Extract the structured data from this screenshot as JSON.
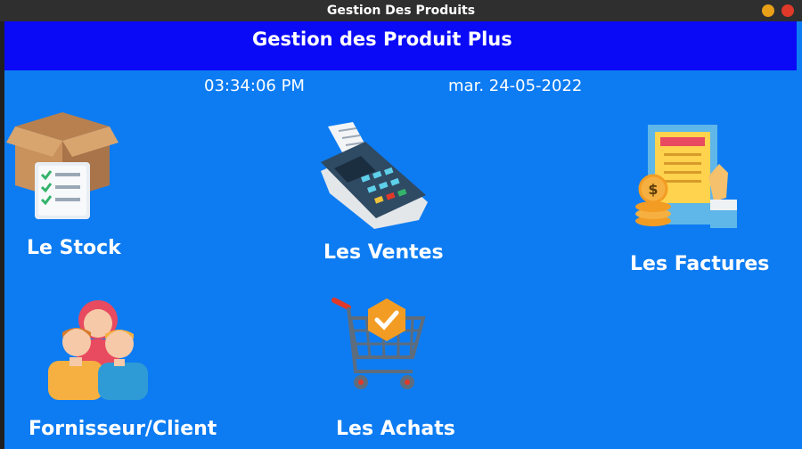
{
  "window": {
    "title": "Gestion Des Produits"
  },
  "header": {
    "title": "Gestion des Produit Plus"
  },
  "status": {
    "time": "03:34:06 PM",
    "date": "mar. 24-05-2022"
  },
  "tiles": [
    {
      "label": "Le Stock",
      "icon": "box-checklist-icon"
    },
    {
      "label": "Les Ventes",
      "icon": "payment-terminal-icon"
    },
    {
      "label": "Les Factures",
      "icon": "invoice-coins-icon"
    },
    {
      "label": "Fornisseur/Client",
      "icon": "people-group-icon"
    },
    {
      "label": "Les Achats",
      "icon": "shopping-cart-icon"
    }
  ],
  "colors": {
    "header": "#0a0af7",
    "background": "#0d7cf2",
    "titlebar": "#2f2f2f"
  }
}
